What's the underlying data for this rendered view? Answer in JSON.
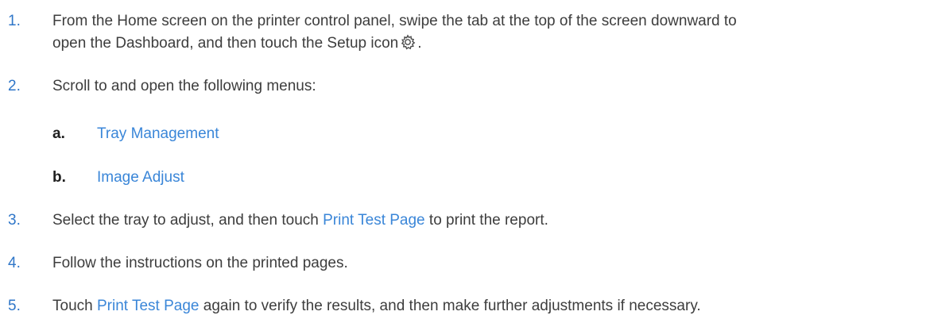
{
  "steps": [
    {
      "number": "1.",
      "line1": "From the Home screen on the printer control panel, swipe the tab at the top of the screen downward to",
      "line2_before": "open the Dashboard, and then touch the Setup icon",
      "icon": "gear-icon",
      "line2_after": "."
    },
    {
      "number": "2.",
      "text": "Scroll to and open the following menus:",
      "substeps": [
        {
          "letter": "a.",
          "link": "Tray Management"
        },
        {
          "letter": "b.",
          "link": "Image Adjust"
        }
      ]
    },
    {
      "number": "3.",
      "before": "Select the tray to adjust, and then touch",
      "link": "Print Test Page",
      "after": "to print the report."
    },
    {
      "number": "4.",
      "text": "Follow the instructions on the printed pages."
    },
    {
      "number": "5.",
      "before": "Touch",
      "link": "Print Test Page",
      "after": "again to verify the results, and then make further adjustments if necessary."
    }
  ],
  "colors": {
    "number": "#2f76c8",
    "link": "#3a86d8",
    "body_text": "#3d3d3d"
  }
}
